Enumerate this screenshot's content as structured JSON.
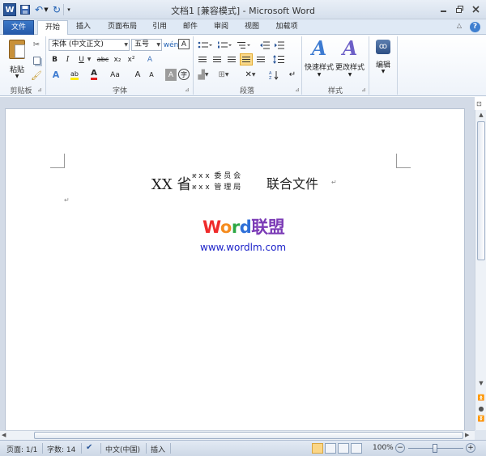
{
  "window": {
    "title": "文档1 [兼容模式] - Microsoft Word",
    "app_icon": "W",
    "controls": {
      "minimize_icon": "minimize-icon",
      "restore_icon": "restore-icon",
      "close_icon": "close-icon"
    }
  },
  "quick_access": {
    "save_icon": "save-icon",
    "undo_icon": "undo-icon",
    "redo_icon": "redo-icon",
    "customize_icon": "dropdown-icon"
  },
  "tabs": {
    "file": "文件",
    "home": "开始",
    "insert": "插入",
    "layout": "页面布局",
    "references": "引用",
    "mailings": "邮件",
    "review": "审阅",
    "view": "视图",
    "addins": "加载项"
  },
  "ribbon": {
    "clipboard": {
      "label": "剪贴板",
      "paste_label": "粘贴"
    },
    "font": {
      "label": "字体",
      "font_name": "宋体 (中文正文)",
      "font_size": "五号",
      "phonetic": "wén",
      "bold": "B",
      "italic": "I",
      "underline": "U",
      "strike": "abc",
      "subscript": "x₂",
      "superscript": "x²",
      "clear_format": "A",
      "text_effect": "A",
      "highlight": "ab",
      "font_color": "A",
      "change_case": "Aa",
      "grow_font": "A",
      "shrink_font": "A",
      "char_border": "A",
      "char_shading": "A",
      "enclose_char": "字"
    },
    "paragraph": {
      "label": "段落"
    },
    "styles": {
      "label": "样式",
      "quick_styles": "快速样式",
      "change_styles": "更改样式"
    },
    "editing": {
      "label": "编辑"
    }
  },
  "document": {
    "heading_prefix": "XX 省",
    "combine_row1": "x x x  委 员 会",
    "combine_row2": "x x x  管 理 局",
    "heading_suffix": "联合文件",
    "paragraph_mark": "↵",
    "watermark_logo": {
      "w": "W",
      "o": "o",
      "r": "r",
      "d": "d",
      "cn": "联盟"
    },
    "watermark_url": "www.wordlm.com",
    "accent_colors": {
      "W": "#ef2b2b",
      "o": "#f58b1e",
      "r": "#2ca744",
      "d": "#2e6fd8",
      "cn": "#7b3bb6",
      "url": "#1c22c9"
    }
  },
  "status": {
    "page": "页面: 1/1",
    "words": "字数: 14",
    "language": "中文(中国)",
    "mode": "插入",
    "zoom": "100%",
    "zoom_percent": 100
  }
}
